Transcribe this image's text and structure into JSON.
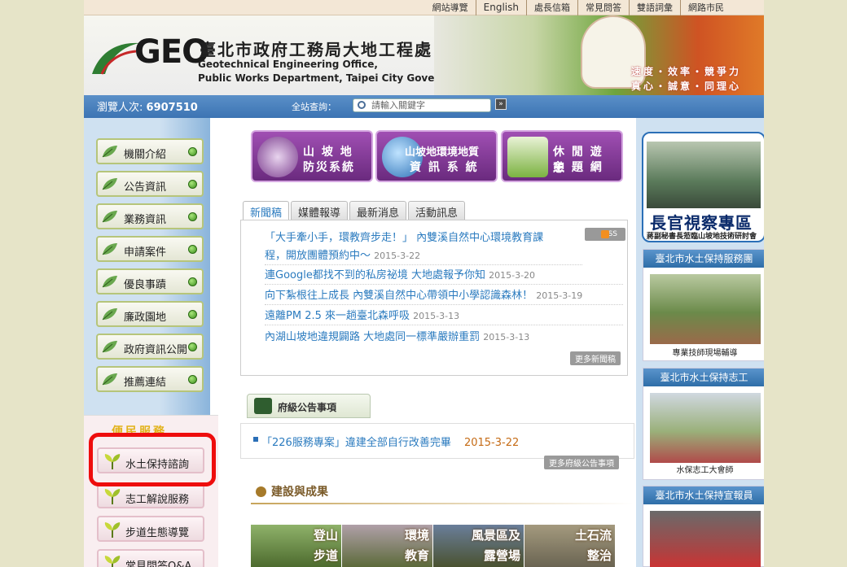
{
  "topbar": {
    "links": [
      "網站導覽",
      "English",
      "處長信箱",
      "常見問答",
      "雙語詞彙",
      "網路市民"
    ]
  },
  "banner": {
    "logo_text": "GEO",
    "org_name_cn": "臺北市政府工務局大地工程處",
    "org_name_en_line1": "Geotechnical Engineering Office,",
    "org_name_en_line2": "Public Works Department, Taipei City Government",
    "slogan_line1": "速度・效率・競爭力",
    "slogan_line2": "真心・誠意・同理心"
  },
  "bluebar": {
    "visitor_label": "瀏覽人次:",
    "visitor_count": "6907510",
    "search_label": "全站查詢：",
    "search_placeholder": "請輸入關鍵字"
  },
  "left_nav": {
    "items": [
      "機關介紹",
      "公告資訊",
      "業務資訊",
      "申請案件",
      "優良事蹟",
      "廉政園地",
      "政府資訊公開",
      "推薦連結"
    ]
  },
  "services": {
    "title": "便民服務",
    "items": [
      "水土保持諮詢",
      "志工解說服務",
      "步道生態導覽",
      "常見問答Q&A"
    ]
  },
  "systems": [
    {
      "line1": "山 坡 地",
      "line2": "防災系統"
    },
    {
      "line1": "山坡地環境地質",
      "line2": "資 訊 系 統"
    },
    {
      "line1": "休 閒 遊 憩",
      "line2": "主 題 網"
    }
  ],
  "news": {
    "tabs": [
      "新聞稿",
      "媒體報導",
      "最新消息",
      "活動訊息"
    ],
    "rss_label": "RSS",
    "items": [
      {
        "title_line1": "「大手牽小手，環教齊步走！」 內雙溪自然中心環境教育課",
        "title_line2": "程，開放團體預約中～",
        "date": "2015-3-22"
      },
      {
        "title_line1": "連Google都找不到的私房祕境 大地處報予你知",
        "title_line2": "",
        "date": "2015-3-20"
      },
      {
        "title_line1": "向下紮根往上成長 內雙溪自然中心帶領中小學認識森林！",
        "title_line2": "",
        "date": "2015-3-19"
      },
      {
        "title_line1": "遠離PM 2.5 來一趟臺北森呼吸",
        "title_line2": "",
        "date": "2015-3-13"
      },
      {
        "title_line1": "內湖山坡地違規闢路 大地處同一標準嚴辦重罰",
        "title_line2": "",
        "date": "2015-3-13"
      }
    ],
    "more_label": "更多新聞稿"
  },
  "gov_notice": {
    "title": "府級公告事項",
    "item_title": "「226服務專案」違建全部自行改善完畢",
    "item_date": "2015-3-22",
    "more_label": "更多府級公告事項"
  },
  "achievements": {
    "title": "建設與成果",
    "tiles": [
      {
        "line1": "登山",
        "line2": "步道"
      },
      {
        "line1": "環境",
        "line2": "教育"
      },
      {
        "line1": "風景區及",
        "line2": "露營場"
      },
      {
        "line1": "土石流",
        "line2": "整治"
      }
    ]
  },
  "right": {
    "officer_title": "長官視察專區",
    "officer_sub": "蔣副秘書長蒞臨山坡地技術研討會",
    "panels": [
      {
        "header": "臺北市水土保持服務團",
        "caption": "專業技師現場輔導"
      },
      {
        "header": "臺北市水土保持志工",
        "caption": "水保志工大會師"
      },
      {
        "header": "臺北市水土保持宣報員",
        "caption": ""
      }
    ]
  },
  "colors": {
    "accent_blue": "#3c74b3",
    "nav_green": "#b6c57a",
    "highlight_red": "#ee0d0d",
    "system_purple": "#6a2a7e",
    "link_blue": "#2b7bbf"
  }
}
